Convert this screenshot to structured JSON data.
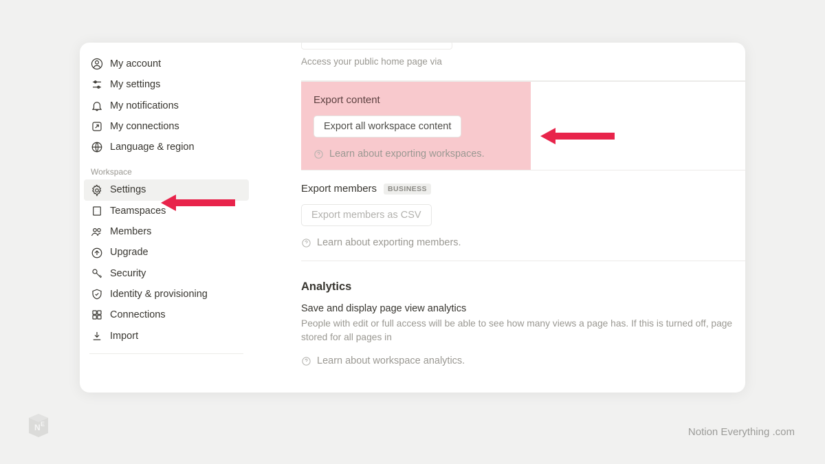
{
  "sidebar": {
    "account_items": [
      {
        "label": "My account"
      },
      {
        "label": "My settings"
      },
      {
        "label": "My notifications"
      },
      {
        "label": "My connections"
      },
      {
        "label": "Language & region"
      }
    ],
    "section_label": "Workspace",
    "workspace_items": [
      {
        "label": "Settings"
      },
      {
        "label": "Teamspaces"
      },
      {
        "label": "Members"
      },
      {
        "label": "Upgrade"
      },
      {
        "label": "Security"
      },
      {
        "label": "Identity & provisioning"
      },
      {
        "label": "Connections"
      },
      {
        "label": "Import"
      }
    ]
  },
  "main": {
    "top_hint_prefix": "Access your public home page via ",
    "top_hint_link": "",
    "export_content": {
      "title": "Export content",
      "button": "Export all workspace content",
      "learn": "Learn about exporting workspaces."
    },
    "export_members": {
      "title": "Export members",
      "badge": "BUSINESS",
      "button": "Export members as CSV",
      "learn": "Learn about exporting members."
    },
    "analytics": {
      "title": "Analytics",
      "subtitle": "Save and display page view analytics",
      "desc_1": "People with edit or full access will be able to see how many views a page has. If this is turned off, page",
      "desc_2_prefix": "stored for all pages in ",
      "desc_2_workspace": "",
      "learn": "Learn about workspace analytics."
    }
  },
  "branding": {
    "name": "Notion Everything",
    "suffix": " .com"
  }
}
